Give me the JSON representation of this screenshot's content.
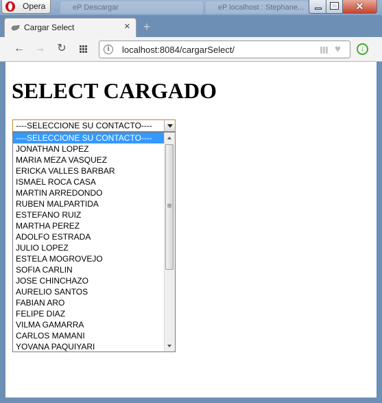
{
  "window": {
    "app_button_label": "Opera",
    "background_tabs": [
      "eP Descargar",
      "eP localhost : Stephane..."
    ]
  },
  "tab": {
    "title": "Cargar Select",
    "close_glyph": "×",
    "new_tab_glyph": "+"
  },
  "toolbar": {
    "back_glyph": "←",
    "forward_glyph": "→",
    "reload_glyph": "↻",
    "info_glyph": "i",
    "heart_glyph": "♥",
    "download_glyph": "↓",
    "url": "localhost:8084/cargarSelect/"
  },
  "page": {
    "heading": "SELECT CARGADO",
    "select": {
      "selected": "----SELECCIONE SU CONTACTO----",
      "options": [
        "----SELECCIONE SU CONTACTO----",
        "JONATHAN LOPEZ",
        "MARIA MEZA VASQUEZ",
        "ERICKA VALLES BARBAR",
        "ISMAEL ROCA CASA",
        "MARTIN ARREDONDO",
        "RUBEN MALPARTIDA",
        "ESTEFANO RUIZ",
        "MARTHA PEREZ",
        "ADOLFO ESTRADA",
        "JULIO LOPEZ",
        "ESTELA MOGROVEJO",
        "SOFIA CARLIN",
        "JOSE CHINCHAZO",
        "AURELIO SANTOS",
        "FABIAN ARO",
        "FELIPE DIAZ",
        "VILMA GAMARRA",
        "CARLOS MAMANI",
        "YOVANA PAQUIYARI"
      ]
    }
  },
  "colors": {
    "selection": "#3399ff",
    "select_focus_border": "#c08a2e",
    "window_frame": "#6d8fb5"
  }
}
